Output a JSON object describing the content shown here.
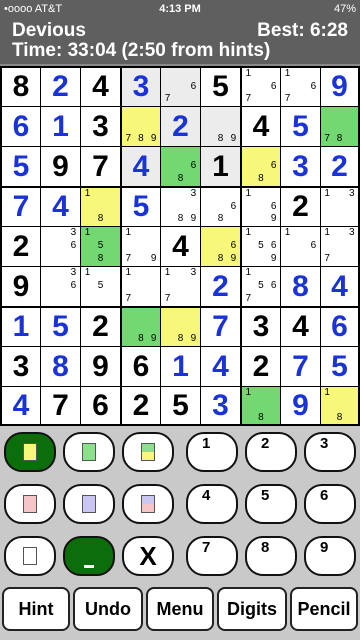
{
  "status_bar": {
    "carrier": "•oooo AT&T",
    "time": "4:13 PM",
    "battery": "47%"
  },
  "header": {
    "puzzle_name": "Devious",
    "best": "Best: 6:28",
    "timer": "Time: 33:04 (2:50 from hints)"
  },
  "board": {
    "rows": [
      [
        {
          "v": "8",
          "k": "black"
        },
        {
          "v": "2",
          "k": "blue"
        },
        {
          "v": "4",
          "k": "black"
        },
        {
          "v": "3",
          "k": "blue",
          "bg": "l"
        },
        {
          "n": [
            7,
            6
          ],
          "bg": "l"
        },
        {
          "v": "5",
          "k": "black"
        },
        {
          "n": [
            1,
            6,
            7
          ]
        },
        {
          "n": [
            1,
            6,
            7
          ]
        },
        {
          "v": "9",
          "k": "blue"
        }
      ],
      [
        {
          "v": "6",
          "k": "blue"
        },
        {
          "v": "1",
          "k": "blue"
        },
        {
          "v": "3",
          "k": "black"
        },
        {
          "n": [
            7,
            8,
            9
          ],
          "bg": "y"
        },
        {
          "v": "2",
          "k": "blue",
          "bg": "l"
        },
        {
          "n": [
            8,
            9
          ],
          "bg": "l"
        },
        {
          "v": "4",
          "k": "black"
        },
        {
          "v": "5",
          "k": "blue"
        },
        {
          "n": [
            7,
            8
          ],
          "bg": "g"
        }
      ],
      [
        {
          "v": "5",
          "k": "blue"
        },
        {
          "v": "9",
          "k": "black"
        },
        {
          "v": "7",
          "k": "black"
        },
        {
          "v": "4",
          "k": "blue",
          "bg": "l"
        },
        {
          "n": [
            6,
            8
          ],
          "bg": "g"
        },
        {
          "v": "1",
          "k": "black",
          "bg": "l"
        },
        {
          "n": [
            6,
            8
          ],
          "bg": "y"
        },
        {
          "v": "3",
          "k": "blue"
        },
        {
          "v": "2",
          "k": "blue"
        }
      ],
      [
        {
          "v": "7",
          "k": "blue"
        },
        {
          "v": "4",
          "k": "blue"
        },
        {
          "n": [
            1,
            8
          ],
          "bg": "y"
        },
        {
          "v": "5",
          "k": "blue"
        },
        {
          "n": [
            3,
            8,
            9
          ]
        },
        {
          "n": [
            6,
            8
          ]
        },
        {
          "n": [
            1,
            6,
            9
          ]
        },
        {
          "v": "2",
          "k": "black"
        },
        {
          "n": [
            1,
            3
          ]
        }
      ],
      [
        {
          "v": "2",
          "k": "black"
        },
        {
          "n": [
            3,
            6
          ]
        },
        {
          "n": [
            1,
            5,
            8
          ],
          "bg": "g"
        },
        {
          "n": [
            1,
            7,
            9
          ]
        },
        {
          "v": "4",
          "k": "black"
        },
        {
          "n": [
            6,
            8,
            9
          ],
          "bg": "y"
        },
        {
          "n": [
            1,
            5,
            6,
            9
          ]
        },
        {
          "n": [
            1,
            6
          ]
        },
        {
          "n": [
            1,
            3,
            7
          ]
        }
      ],
      [
        {
          "v": "9",
          "k": "black"
        },
        {
          "n": [
            3,
            6
          ]
        },
        {
          "n": [
            1,
            5
          ]
        },
        {
          "n": [
            1,
            7
          ]
        },
        {
          "n": [
            1,
            3,
            7
          ]
        },
        {
          "v": "2",
          "k": "blue"
        },
        {
          "n": [
            1,
            5,
            6,
            7
          ]
        },
        {
          "v": "8",
          "k": "blue"
        },
        {
          "v": "4",
          "k": "blue"
        }
      ],
      [
        {
          "v": "1",
          "k": "blue"
        },
        {
          "v": "5",
          "k": "blue"
        },
        {
          "v": "2",
          "k": "black"
        },
        {
          "n": [
            8,
            9
          ],
          "bg": "g"
        },
        {
          "n": [
            8,
            9
          ],
          "bg": "y"
        },
        {
          "v": "7",
          "k": "blue"
        },
        {
          "v": "3",
          "k": "black"
        },
        {
          "v": "4",
          "k": "black"
        },
        {
          "v": "6",
          "k": "blue"
        }
      ],
      [
        {
          "v": "3",
          "k": "black"
        },
        {
          "v": "8",
          "k": "blue"
        },
        {
          "v": "9",
          "k": "black"
        },
        {
          "v": "6",
          "k": "black"
        },
        {
          "v": "1",
          "k": "blue"
        },
        {
          "v": "4",
          "k": "blue"
        },
        {
          "v": "2",
          "k": "black"
        },
        {
          "v": "7",
          "k": "blue"
        },
        {
          "v": "5",
          "k": "blue"
        }
      ],
      [
        {
          "v": "4",
          "k": "blue"
        },
        {
          "v": "7",
          "k": "black"
        },
        {
          "v": "6",
          "k": "black"
        },
        {
          "v": "2",
          "k": "black"
        },
        {
          "v": "5",
          "k": "black"
        },
        {
          "v": "3",
          "k": "blue"
        },
        {
          "n": [
            1,
            8
          ],
          "bg": "g"
        },
        {
          "v": "9",
          "k": "blue"
        },
        {
          "n": [
            1,
            8
          ],
          "bg": "y"
        }
      ]
    ]
  },
  "colors": {
    "given": "#000000",
    "entered": "#1a33d6",
    "yellow": "#f7f77a",
    "green": "#72d872",
    "dark_green": "#0b6e0b",
    "pink": "#f6c6c6",
    "purple": "#c9c6f2"
  },
  "palette": {
    "color_buttons": [
      {
        "name": "yellow-highlight-button",
        "swatch": "#f7f77a",
        "selected": true
      },
      {
        "name": "green-highlight-button",
        "swatch": "#8be08b"
      },
      {
        "name": "green-yellow-highlight-button",
        "swatch": "split"
      },
      {
        "name": "pink-highlight-button",
        "swatch": "#f6c6c6"
      },
      {
        "name": "purple-highlight-button",
        "swatch": "#c9c6f2"
      },
      {
        "name": "purple-pink-highlight-button",
        "swatch": "split-pp"
      },
      {
        "name": "white-highlight-button",
        "swatch": "#ffffff"
      },
      {
        "name": "fill-highlight-button",
        "swatch": "fill"
      },
      {
        "name": "clear-button",
        "label": "X"
      }
    ],
    "digits": [
      "1",
      "2",
      "3",
      "4",
      "5",
      "6",
      "7",
      "8",
      "9"
    ]
  },
  "toolbar": {
    "hint": "Hint",
    "undo": "Undo",
    "menu": "Menu",
    "digits": "Digits",
    "pencil": "Pencil"
  }
}
